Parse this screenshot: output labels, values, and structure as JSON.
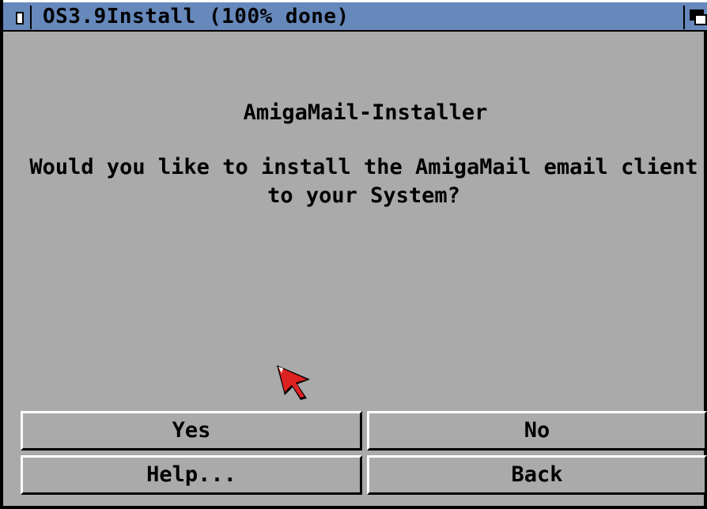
{
  "window": {
    "title": "OS3.9Install (100% done)"
  },
  "dialog": {
    "heading": "AmigaMail-Installer",
    "question_line1": "Would you like to install the AmigaMail email client",
    "question_line2": "to your System?"
  },
  "buttons": {
    "yes": "Yes",
    "no": "No",
    "help": "Help...",
    "back": "Back"
  },
  "icons": {
    "close": "close-icon",
    "depth": "depth-arrange-icon",
    "pointer": "mouse-pointer-icon"
  },
  "colors": {
    "titlebar": "#6688bb",
    "background": "#aaaaaa",
    "pointer": "#dd2222"
  }
}
